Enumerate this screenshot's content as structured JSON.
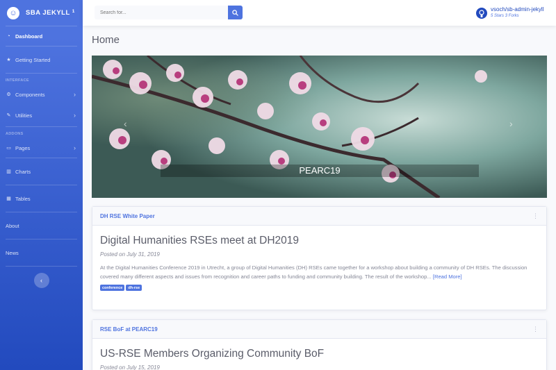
{
  "sidebar": {
    "brand": "SBA JEKYLL",
    "brand_sup": "1",
    "items": [
      {
        "label": "Dashboard",
        "icon": "dashboard-icon"
      },
      {
        "label": "Getting Started",
        "icon": "star-icon"
      },
      {
        "label": "Components",
        "icon": "gear-icon"
      },
      {
        "label": "Utilities",
        "icon": "wrench-icon"
      },
      {
        "label": "Pages",
        "icon": "folder-icon"
      },
      {
        "label": "Charts",
        "icon": "chart-icon"
      },
      {
        "label": "Tables",
        "icon": "table-icon"
      },
      {
        "label": "About",
        "icon": ""
      },
      {
        "label": "News",
        "icon": ""
      }
    ],
    "headings": [
      "INTERFACE",
      "ADDONS"
    ],
    "toggle_icon": "chevron-left-icon"
  },
  "topbar": {
    "search_placeholder": "Search for...",
    "repo_name": "vsoch/sb-admin-jekyll",
    "repo_stats": "5 Stars 3 Forks"
  },
  "page_title": "Home",
  "carousel": {
    "caption": "PEARC19",
    "prev_icon": "chevron-left-icon",
    "next_icon": "chevron-right-icon"
  },
  "posts": [
    {
      "header": "DH RSE White Paper",
      "title": "Digital Humanities RSEs meet at DH2019",
      "date": "Posted on July 31, 2019",
      "excerpt": "At the Digital Humanities Conference 2019 in Utrecht, a group of Digital Humanities (DH) RSEs came together for a workshop about building a community of DH RSEs. The discussion covered many different aspects and issues from recognition and career paths to funding and community building. The result of the workshop...",
      "read_more": "[Read More]",
      "tags": [
        "conference",
        "dh-rse"
      ]
    },
    {
      "header": "RSE BoF at PEARC19",
      "title": "US-RSE Members Organizing Community BoF",
      "date": "Posted on July 15, 2019"
    }
  ],
  "colors": {
    "primary": "#4e73df",
    "sidebar_end": "#224abe",
    "text": "#5a5c69",
    "muted": "#858796"
  }
}
